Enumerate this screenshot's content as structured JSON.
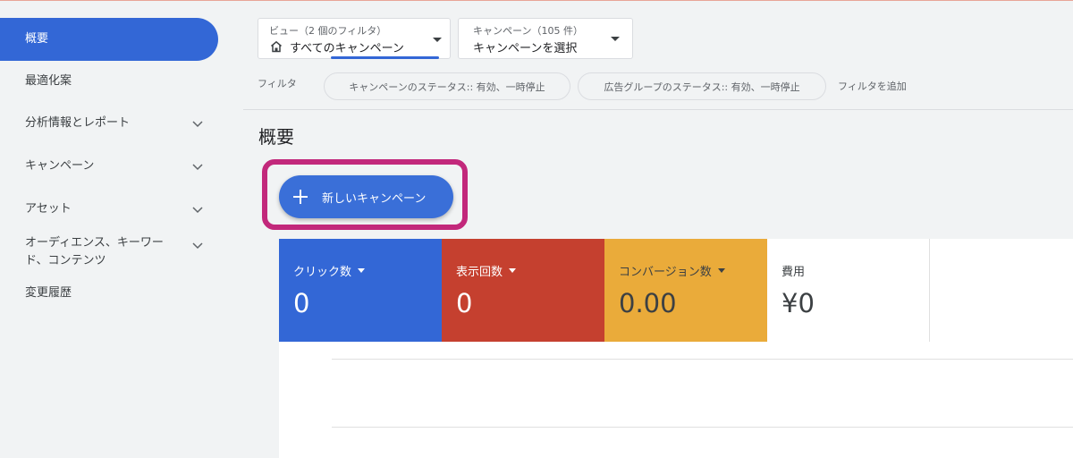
{
  "sidebar": {
    "items": [
      {
        "label": "概要",
        "active": true,
        "expandable": false
      },
      {
        "label": "最適化案",
        "active": false,
        "expandable": false
      },
      {
        "label": "分析情報とレポート",
        "active": false,
        "expandable": true
      },
      {
        "label": "キャンペーン",
        "active": false,
        "expandable": true
      },
      {
        "label": "アセット",
        "active": false,
        "expandable": true
      },
      {
        "label": "オーディエンス、キーワード、コンテンツ",
        "active": false,
        "expandable": true
      },
      {
        "label": "変更履歴",
        "active": false,
        "expandable": false
      }
    ]
  },
  "view_selector": {
    "caption": "ビュー（2 個のフィルタ）",
    "value": "すべてのキャンペーン",
    "icon": "home-icon"
  },
  "campaign_selector": {
    "caption": "キャンペーン（105 件）",
    "value": "キャンペーンを選択"
  },
  "filter_bar": {
    "label": "フィルタ",
    "chips": [
      "キャンペーンのステータス:: 有効、一時停止",
      "広告グループのステータス:: 有効、一時停止"
    ],
    "add_filter": "フィルタを追加"
  },
  "page_title": "概要",
  "new_campaign_button": {
    "label": "新しいキャンペーン",
    "icon": "plus-icon"
  },
  "metrics": [
    {
      "label": "クリック数",
      "value": "0",
      "dropdown": true,
      "bg": "#3367d6",
      "fg": "#ffffff"
    },
    {
      "label": "表示回数",
      "value": "0",
      "dropdown": true,
      "bg": "#c5402f",
      "fg": "#ffffff"
    },
    {
      "label": "コンバージョン数",
      "value": "0.00",
      "dropdown": true,
      "bg": "#eaab3a",
      "fg": "#3c4043"
    },
    {
      "label": "費用",
      "value": "¥0",
      "dropdown": false,
      "bg": "#ffffff",
      "fg": "#3c4043"
    }
  ],
  "colors": {
    "accent": "#3367d6",
    "highlight": "#c2287b"
  }
}
